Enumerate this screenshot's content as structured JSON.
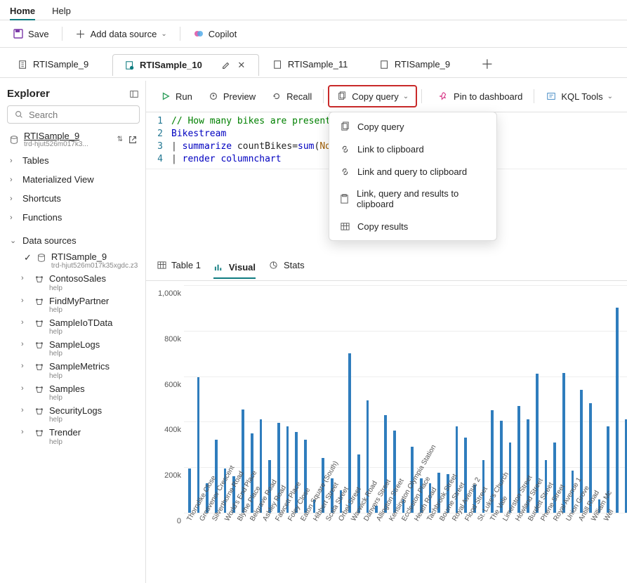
{
  "top_menu": {
    "home": "Home",
    "help": "Help"
  },
  "toolbar": {
    "save": "Save",
    "add_source": "Add data source",
    "copilot": "Copilot"
  },
  "tabs": [
    {
      "label": "RTISample_9",
      "active": false
    },
    {
      "label": "RTISample_10",
      "active": true
    },
    {
      "label": "RTISample_11",
      "active": false
    },
    {
      "label": "RTISample_9",
      "active": false
    }
  ],
  "explorer": {
    "title": "Explorer",
    "search_placeholder": "Search",
    "db": {
      "name": "RTISample_9",
      "sub": "trd-hjut526m017k3..."
    },
    "groups": [
      "Tables",
      "Materialized View",
      "Shortcuts",
      "Functions"
    ],
    "data_sources_label": "Data sources",
    "checked_source": {
      "name": "RTISample_9",
      "sub": "trd-hjut526m017k35xgdc.z3"
    },
    "sources": [
      {
        "name": "ContosoSales",
        "help": "help"
      },
      {
        "name": "FindMyPartner",
        "help": "help"
      },
      {
        "name": "SampleIoTData",
        "help": "help"
      },
      {
        "name": "SampleLogs",
        "help": "help"
      },
      {
        "name": "SampleMetrics",
        "help": "help"
      },
      {
        "name": "Samples",
        "help": "help"
      },
      {
        "name": "SecurityLogs",
        "help": "help"
      },
      {
        "name": "Trender",
        "help": "help"
      }
    ]
  },
  "query_bar": {
    "run": "Run",
    "preview": "Preview",
    "recall": "Recall",
    "copy_query": "Copy query",
    "pin": "Pin to dashboard",
    "tools": "KQL Tools"
  },
  "copy_menu": [
    "Copy query",
    "Link to clipboard",
    "Link and query to clipboard",
    "Link, query and results to clipboard",
    "Copy results"
  ],
  "editor": {
    "line_numbers": [
      "1",
      "2",
      "3",
      "4"
    ],
    "l1": "// How many bikes are present",
    "l2": "Bikestream",
    "l3_a": "| ",
    "l3_b": "summarize",
    "l3_c": " countBikes=",
    "l3_d": "sum",
    "l3_e": "(",
    "l3_f": "No_",
    "l3_g": "",
    "l4_a": "| ",
    "l4_b": "render",
    "l4_c": " ",
    "l4_d": "columnchart"
  },
  "result_tabs": {
    "table": "Table 1",
    "visual": "Visual",
    "stats": "Stats"
  },
  "chart_data": {
    "type": "bar",
    "ylim": [
      0,
      1000000
    ],
    "yticks": [
      "0",
      "200k",
      "400k",
      "600k",
      "800k",
      "1,000k"
    ],
    "categories": [
      "Thorndike Close",
      "Grosvenor Crescent",
      "Silverthorne Road",
      "World's End Place",
      "Blythe Place",
      "Belgrave Road",
      "Ashley Road",
      "Fawcett Place",
      "Foley Close",
      "Eaton Square (South)",
      "Hibbert Street",
      "Scala Street",
      "Orbel Street",
      "Warwick Road",
      "Danvers Street",
      "Allington Street",
      "Kensington Olympia Station",
      "Eccleston Place",
      "Heath Road",
      "Tachbrook Street",
      "Bourne Street",
      "Royal Avenue 2",
      "Flood Street",
      "St. Luke's Church",
      "The Vale",
      "Limerston Street",
      "Howland Street",
      "Burdett Street",
      "Phene Street",
      "Royal Avenue 1",
      "Union Grove",
      "Antill Road",
      "William Mc",
      "Wel"
    ],
    "values": [
      195000,
      595000,
      130000,
      320000,
      195000,
      160000,
      455000,
      350000,
      410000,
      230000,
      395000,
      380000,
      355000,
      320000,
      60000,
      240000,
      150000,
      100000,
      700000,
      255000,
      495000,
      30000,
      430000,
      360000,
      60000,
      290000,
      150000,
      130000,
      175000,
      170000,
      380000,
      330000,
      125000,
      230000,
      450000,
      405000,
      310000,
      470000,
      410000,
      610000,
      230000,
      310000,
      615000,
      185000,
      540000,
      480000,
      60000,
      380000,
      900000,
      410000
    ]
  }
}
